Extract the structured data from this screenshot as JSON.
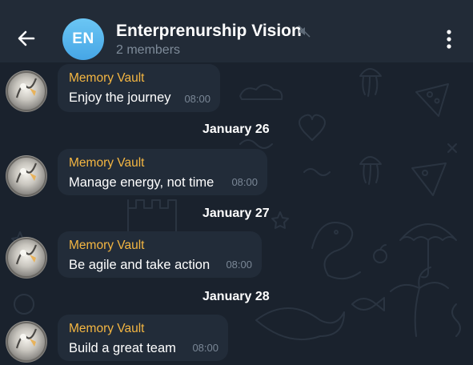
{
  "header": {
    "title": "Enterprenurship Vision",
    "subtitle": "2 members",
    "avatar_initials": "EN",
    "back_icon": "arrow-left-icon",
    "mute_icon": "muted-speaker-icon",
    "menu_icon": "vertical-dots-icon"
  },
  "colors": {
    "header_bg": "#222b37",
    "chat_bg": "#1a222d",
    "bubble_bg": "#222c39",
    "sender_name": "#f4b642",
    "avatar_gradient_top": "#6bc6f4",
    "avatar_gradient_bottom": "#46a6e6"
  },
  "messages": [
    {
      "sender": "Memory Vault",
      "text": "Enjoy the journey",
      "time": "08:00"
    },
    {
      "sender": "Memory Vault",
      "text": "Manage energy, not time",
      "time": "08:00"
    },
    {
      "sender": "Memory Vault",
      "text": "Be agile and take action",
      "time": "08:00"
    },
    {
      "sender": "Memory Vault",
      "text": "Build a great team",
      "time": "08:00"
    }
  ],
  "date_separators": [
    "January 26",
    "January 27",
    "January 28"
  ]
}
